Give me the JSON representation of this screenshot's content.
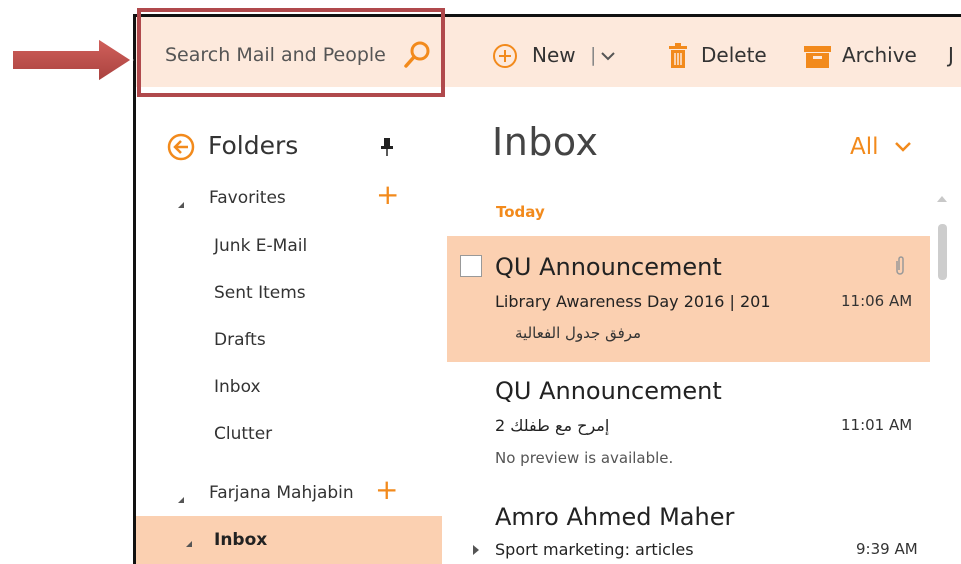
{
  "search": {
    "placeholder": "Search Mail and People"
  },
  "toolbar": {
    "new_label": "New",
    "separator": "|",
    "delete_label": "Delete",
    "archive_label": "Archive",
    "junk_label": "J"
  },
  "folders": {
    "title": "Folders",
    "favorites_label": "Favorites",
    "add_symbol": "+",
    "items": [
      "Junk E-Mail",
      "Sent Items",
      "Drafts",
      "Inbox",
      "Clutter"
    ],
    "account_label": "Farjana Mahjabin",
    "inbox_label": "Inbox"
  },
  "list": {
    "title": "Inbox",
    "filter_label": "All",
    "group_today": "Today",
    "messages": [
      {
        "sender": "QU Announcement",
        "subject": "Library Awareness Day 2016 | 201",
        "time": "11:06 AM",
        "preview": "مرفق جدول الفعالية"
      },
      {
        "sender": "QU Announcement",
        "subject": "إمرح مع طفلك 2",
        "time": "11:01 AM",
        "preview": "No preview is available."
      },
      {
        "sender": "Amro Ahmed Maher",
        "subject": "Sport marketing: articles",
        "time": "9:39 AM"
      }
    ]
  },
  "colors": {
    "accent": "#f28a1c",
    "selection": "#fbd0b1",
    "toolbar_bg": "#fde9dc",
    "highlight_border": "#b0494c",
    "arrow": "#c0504d"
  },
  "icons": {
    "search": "search-icon",
    "new": "plus-circle-icon",
    "delete": "trash-icon",
    "archive": "archive-box-icon",
    "back": "back-arrow-circle-icon",
    "pin": "pin-icon",
    "attachment": "paperclip-icon",
    "pointer": "arrow-right-icon"
  }
}
